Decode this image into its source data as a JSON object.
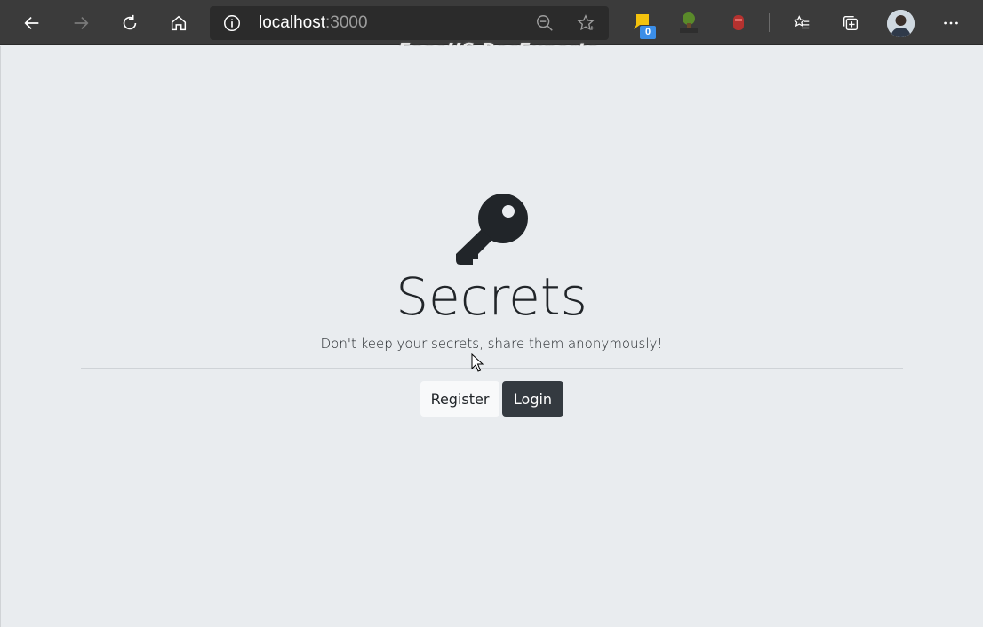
{
  "browser": {
    "url_host": "localhost",
    "url_port": ":3000",
    "extension_badge": "0",
    "watermark": "EaseUS RecExperts"
  },
  "page": {
    "title": "Secrets",
    "lead": "Don't keep your secrets, share them anonymously!",
    "register_label": "Register",
    "login_label": "Login"
  },
  "colors": {
    "background": "#e9ecef",
    "btn_light": "#f8f9fa",
    "btn_dark": "#343a40",
    "text": "#212529"
  },
  "icons": [
    "back-icon",
    "forward-icon",
    "refresh-icon",
    "home-icon",
    "info-icon",
    "zoom-out-icon",
    "favorite-star-icon",
    "extension-icon",
    "html-extension-icon",
    "extension-red-icon",
    "favorites-list-icon",
    "collections-icon",
    "profile-avatar",
    "more-icon",
    "key-icon"
  ]
}
